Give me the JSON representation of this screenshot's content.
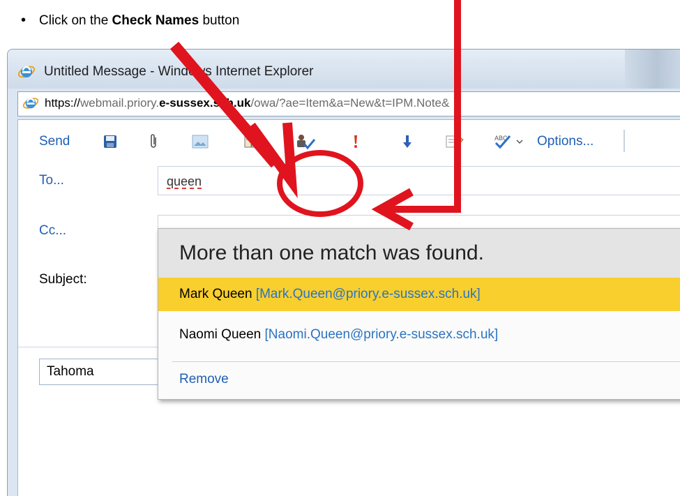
{
  "instruction": {
    "bullet": "•",
    "prefix": "Click on the ",
    "bold": "Check Names",
    "suffix": " button"
  },
  "window": {
    "title": "Untitled Message - Windows Internet Explorer",
    "address": {
      "scheme": "https://",
      "host_pre": "webmail.priory.",
      "host_bold": "e-sussex.sch.uk",
      "path": "/owa/?ae=Item&a=New&t=IPM.Note&"
    }
  },
  "toolbar": {
    "send_label": "Send",
    "options_label": "Options...",
    "icons": [
      "save-icon",
      "attach-icon",
      "insert-image-icon",
      "address-book-icon",
      "check-names-icon",
      "importance-high-icon",
      "importance-low-icon",
      "signature-icon",
      "spell-check-icon"
    ]
  },
  "form": {
    "to_label": "To...",
    "to_value": "queen",
    "cc_label": "Cc...",
    "subject_label": "Subject:",
    "font_name": "Tahoma"
  },
  "suggestions": {
    "header": "More than one match was found.",
    "items": [
      {
        "name": "Mark Queen",
        "email": "[Mark.Queen@priory.e-sussex.sch.uk]",
        "selected": true
      },
      {
        "name": "Naomi Queen",
        "email": "[Naomi.Queen@priory.e-sussex.sch.uk]",
        "selected": false
      }
    ],
    "remove_label": "Remove"
  },
  "colors": {
    "link_blue": "#1f5fb5",
    "selected_row": "#f9cf2d",
    "annotation_red": "#e0141e"
  }
}
